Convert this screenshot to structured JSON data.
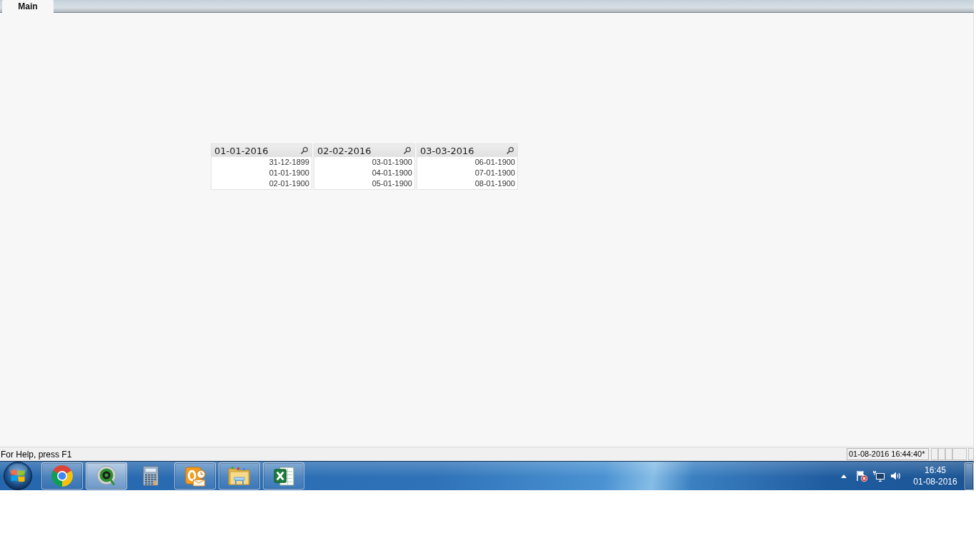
{
  "tabs": [
    {
      "label": "Main",
      "selected": true
    }
  ],
  "list_boxes": [
    {
      "title": "01-01-2016",
      "values": [
        "31-12-1899",
        "01-01-1900",
        "02-01-1900"
      ]
    },
    {
      "title": "02-02-2016",
      "values": [
        "03-01-1900",
        "04-01-1900",
        "05-01-1900"
      ]
    },
    {
      "title": "03-03-2016",
      "values": [
        "06-01-1900",
        "07-01-1900",
        "08-01-1900"
      ]
    }
  ],
  "status_bar": {
    "help_text": "For Help, press F1",
    "timestamp": "01-08-2016 16:44:40*"
  },
  "taskbar": {
    "apps": [
      {
        "kind": "chrome",
        "running": true,
        "selected": false
      },
      {
        "kind": "qlikview",
        "running": true,
        "selected": true
      },
      {
        "kind": "calculator",
        "running": false,
        "selected": false
      },
      {
        "kind": "outlook",
        "running": true,
        "selected": false
      },
      {
        "kind": "explorer",
        "running": true,
        "selected": false
      },
      {
        "kind": "excel",
        "running": true,
        "selected": false
      }
    ],
    "clock": {
      "time": "16:45",
      "date": "01-08-2016"
    }
  }
}
